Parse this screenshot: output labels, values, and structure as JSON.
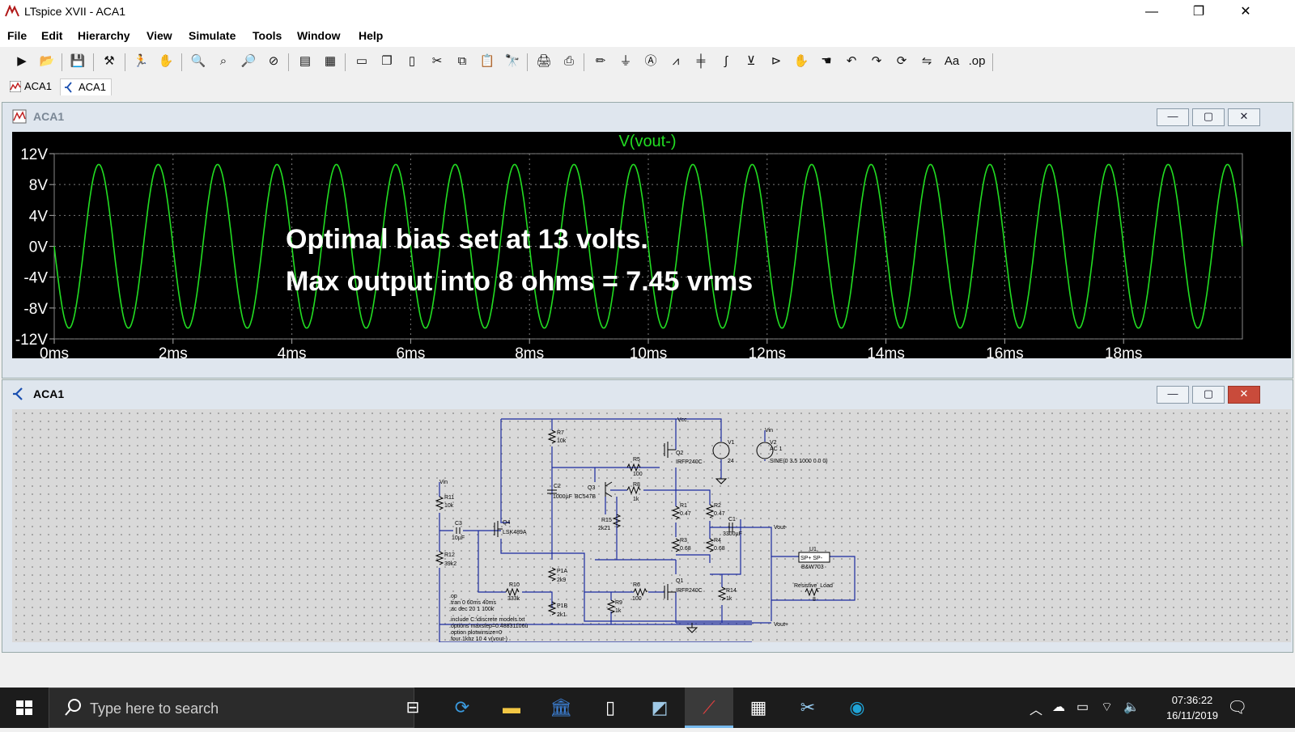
{
  "window": {
    "title": "LTspice XVII - ACA1",
    "controls": {
      "minimize": "—",
      "maximize": "❐",
      "close": "✕"
    }
  },
  "menu": [
    "File",
    "Edit",
    "Hierarchy",
    "View",
    "Simulate",
    "Tools",
    "Window",
    "Help"
  ],
  "toolbar_icons": [
    "new-schematic-icon",
    "open-icon",
    "save-icon",
    "control-panel-icon",
    "run-icon",
    "halt-icon",
    "zoom-in-icon",
    "zoom-fit-icon",
    "zoom-out-icon",
    "zoom-cancel-icon",
    "autorange-icon",
    "mark-icon",
    "tile-horizontal-icon",
    "cascade-icon",
    "tile-vertical-icon",
    "cut-icon",
    "copy-icon",
    "paste-icon",
    "find-icon",
    "print-icon",
    "print-setup-icon",
    "draw-wire-icon",
    "ground-icon",
    "label-net-icon",
    "resistor-icon",
    "capacitor-icon",
    "inductor-icon",
    "diode-icon",
    "component-icon",
    "move-icon",
    "drag-icon",
    "undo-icon",
    "redo-icon",
    "rotate-icon",
    "mirror-icon",
    "text-icon",
    "spice-directive-icon"
  ],
  "tabs": [
    {
      "label": "ACA1",
      "icon": "waveform-icon"
    },
    {
      "label": "ACA1",
      "icon": "schematic-icon"
    }
  ],
  "waveform_window": {
    "title": "ACA1",
    "trace_label": "V(vout-)",
    "trace_color": "#22dd22",
    "annotation_line1": "Optimal bias set at 13 volts.",
    "annotation_line2": "Max output  into 8 ohms = 7.45 vrms"
  },
  "chart_data": {
    "type": "line",
    "title": "V(vout-)",
    "xlabel": "",
    "ylabel": "",
    "x_unit": "ms",
    "xlim": [
      0,
      20
    ],
    "ylim": [
      -12,
      12
    ],
    "yticks": [
      "12V",
      "8V",
      "4V",
      "0V",
      "-4V",
      "-8V",
      "-12V"
    ],
    "xticks": [
      "0ms",
      "2ms",
      "4ms",
      "6ms",
      "8ms",
      "10ms",
      "12ms",
      "14ms",
      "16ms",
      "18ms"
    ],
    "grid": true,
    "series": [
      {
        "name": "V(vout-)",
        "waveform": "sine",
        "frequency_hz": 1000,
        "amplitude_v": 10.6,
        "offset_v": 0.0,
        "phase": "inverted",
        "color": "#22dd22"
      }
    ]
  },
  "schematic_window": {
    "title": "ACA1",
    "labels": {
      "vcc": "Vcc",
      "vin_top": "Vin",
      "vin_left": "Vin",
      "vout_minus": "Vout-",
      "vout_plus": "Vout+",
      "r7": "R7",
      "r7v": "10k",
      "r5": "R5",
      "r5v": "100",
      "r8": "R8",
      "r8v": "1k",
      "q2": "Q2",
      "q2v": "IRFP240C",
      "q1": "Q1",
      "q1v": "IRFP240C",
      "q3": "Q3",
      "q3v": "BC547B",
      "q4": "Q4",
      "q4v": "LSK489A",
      "c2": "C2",
      "c2v": "1000µF",
      "c3": "C3",
      "c3v": "10µF",
      "c1": "C1",
      "c1v": "3300µF",
      "r11": "R11",
      "r11v": "10k",
      "r12": "R12",
      "r12v": "39k2",
      "r15": "R15",
      "r15v": "2k21",
      "r1": "R1",
      "r1v": "0.47",
      "r2": "R2",
      "r2v": "0.47",
      "r3": "R3",
      "r3v": "0.68",
      "r4": "R4",
      "r4v": "0.68",
      "p1a": "P1A",
      "p1av": "2k9",
      "p1b": "P1B",
      "p1bv": "2k1",
      "r10": "R10",
      "r10v": "333k",
      "r9": "R9",
      "r9v": "1k",
      "r6": "R6",
      "r6v": "100",
      "r14": "R14",
      "r14v": "1k",
      "v1": "V1",
      "v1v": "24",
      "v2": "V2",
      "v2ac": "AC 1",
      "v2v": "SINE(0 3.5 1000 0 0 0)",
      "u1": "U1",
      "u1pins": "SP+  SP-",
      "u1v": "B&W703",
      "load": "Resistive_Load",
      "loadv": "8",
      "op": ".op",
      "tran": ".tran 0 60ms 40ms",
      "ac": ";ac dec 20 1 100k",
      "include": ".include C:\\discrete models.txt",
      "options1": ".options maxstep=0.48831106u",
      "options2": ".option plotwinsize=0",
      "four": ".four 1khz 10 4 v(vout-)"
    }
  },
  "taskbar": {
    "search_placeholder": "Type here to search",
    "time": "07:36:22",
    "date": "16/11/2019",
    "apps": [
      "task-view-icon",
      "sync-icon",
      "file-explorer-icon",
      "bank-icon",
      "document-icon",
      "notes-icon",
      "ltspice-icon",
      "calculator-icon",
      "scissors-icon",
      "edge-dev-icon"
    ],
    "tray_icons": [
      "chevron-up-icon",
      "onedrive-icon",
      "battery-icon",
      "wifi-icon",
      "volume-icon"
    ]
  }
}
